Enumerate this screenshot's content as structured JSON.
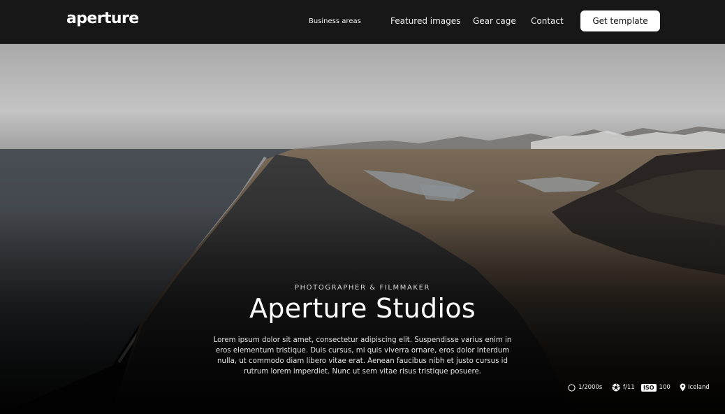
{
  "brand": {
    "logo": "aperture"
  },
  "nav": {
    "items": [
      {
        "label": "Business areas"
      },
      {
        "label": "Featured images"
      },
      {
        "label": "Gear cage"
      },
      {
        "label": "Contact"
      }
    ],
    "cta_label": "Get template"
  },
  "hero": {
    "eyebrow": "PHOTOGRAPHER & FILMMAKER",
    "title": "Aperture Studios",
    "description": "Lorem ipsum dolor sit amet, consectetur adipiscing elit. Suspendisse varius enim in eros elementum tristique. Duis cursus, mi quis viverra ornare, eros dolor interdum nulla, ut commodo diam libero vitae erat. Aenean faucibus nibh et justo cursus id rutrum lorem imperdiet. Nunc ut sem vitae risus tristique posuere."
  },
  "exif": {
    "shutter": {
      "icon": "shutter-icon",
      "value": "1/2000s"
    },
    "aperture": {
      "icon": "aperture-icon",
      "value": "f/11"
    },
    "iso": {
      "icon": "iso-icon",
      "badge": "ISO",
      "value": "100"
    },
    "location": {
      "icon": "location-pin-icon",
      "value": "Iceland"
    }
  },
  "colors": {
    "header_bg": "#171717",
    "cta_bg": "#ffffff",
    "page_bg": "#0b0b0b"
  }
}
